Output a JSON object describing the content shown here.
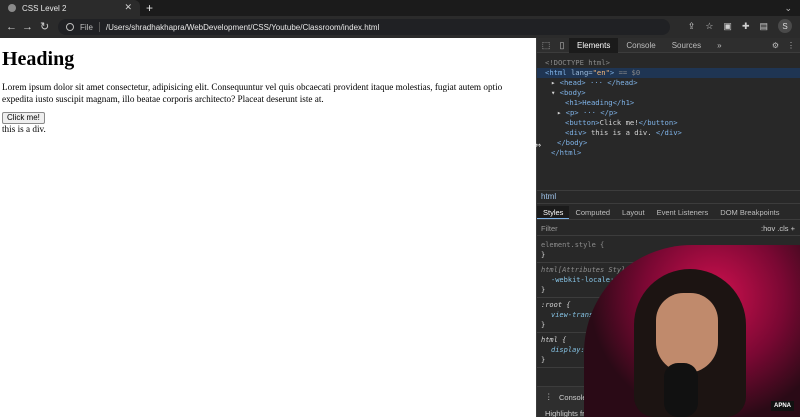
{
  "browser": {
    "tab_title": "CSS Level 2",
    "tab_close": "✕",
    "new_tab": "+",
    "tabs_menu": "⌄",
    "nav": {
      "back": "←",
      "forward": "→",
      "reload": "↻"
    },
    "scheme_label": "File",
    "url": "/Users/shradhakhapra/WebDevelopment/CSS/Youtube/Classroom/index.html",
    "toolbar_icons": [
      "share-icon",
      "star-icon",
      "extension-icon",
      "puzzle-icon",
      "sidepanel-icon"
    ],
    "profile_initial": "S"
  },
  "page": {
    "heading": "Heading",
    "paragraph": "Lorem ipsum dolor sit amet consectetur, adipisicing elit. Consequuntur vel quis obcaecati provident itaque molestias, fugiat autem optio expedita iusto suscipit magnam, illo beatae corporis architecto? Placeat deserunt iste at.",
    "button_label": "Click me!",
    "div_text": "this is a div."
  },
  "devtools": {
    "tabs": [
      "Elements",
      "Console",
      "Sources"
    ],
    "active_tab": "Elements",
    "more_tabs": "»",
    "dom": {
      "doctype": "<!DOCTYPE html>",
      "html_open_tag": "<html",
      "html_attr_name": " lang=",
      "html_attr_value": "\"en\"",
      "html_close_bracket": ">",
      "html_selected_marker": "== $0",
      "head": "<head> ··· </head>",
      "body_open": "<body>",
      "h1": "<h1>Heading</h1>",
      "p": "<p> ··· </p>",
      "button_open": "<button>",
      "button_text": "Click me!",
      "button_close": "</button>",
      "div_open": "<div>",
      "div_text": " this is a div. ",
      "div_close": "</div>",
      "body_close": "</body>",
      "html_close": "</html>"
    },
    "breadcrumb": "html",
    "styles_tabs": [
      "Styles",
      "Computed",
      "Layout",
      "Event Listeners",
      "DOM Breakpoints"
    ],
    "active_styles_tab": "Styles",
    "filter_placeholder": "Filter",
    "filter_right": ":hov  .cls  +",
    "rules": {
      "element_style": "element.style {",
      "close": "}",
      "attr_style": "html[Attributes Style] {",
      "attr_prop": "-webkit-locale: \"en\"",
      "root": ":root {",
      "root_prop": "view-transit",
      "html_rule": "html {",
      "html_prop": "display: b"
    },
    "drawer_tab": "Console",
    "drawer_text": "Highlights fro"
  },
  "webcam": {
    "logo_text": "APNA"
  }
}
